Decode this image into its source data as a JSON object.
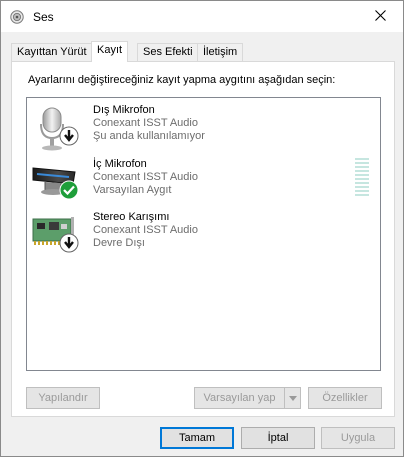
{
  "window": {
    "title": "Ses",
    "icon": "speaker-icon",
    "close_icon": "close-icon"
  },
  "tabs": [
    {
      "label": "Kayıttan Yürüt",
      "active": false
    },
    {
      "label": "Kayıt",
      "active": true
    },
    {
      "label": "Ses Efekti",
      "active": false
    },
    {
      "label": "İletişim",
      "active": false
    }
  ],
  "panel": {
    "instruction": "Ayarlarını değiştireceğiniz kayıt yapma aygıtını aşağıdan seçin:"
  },
  "devices": [
    {
      "name": "Dış Mikrofon",
      "driver": "Conexant ISST Audio",
      "status": "Şu anda kullanılamıyor",
      "icon": "microphone-icon",
      "badge": "down-arrow-badge-icon"
    },
    {
      "name": "İç Mikrofon",
      "driver": "Conexant ISST Audio",
      "status": "Varsayılan Aygıt",
      "icon": "microphone-array-icon",
      "badge": "checkmark-badge-icon",
      "level": 0
    },
    {
      "name": "Stereo Karışımı",
      "driver": "Conexant ISST Audio",
      "status": "Devre Dışı",
      "icon": "sound-card-icon",
      "badge": "down-arrow-badge-icon"
    }
  ],
  "buttons": {
    "configure": "Yapılandır",
    "set_default": "Varsayılan yap",
    "properties": "Özellikler",
    "ok": "Tamam",
    "cancel": "İptal",
    "apply": "Uygula"
  },
  "colors": {
    "accent": "#0078d7",
    "check_green": "#1e9e3a",
    "disabled_text": "#9a9a9a",
    "secondary_text": "#6d6d6d"
  }
}
